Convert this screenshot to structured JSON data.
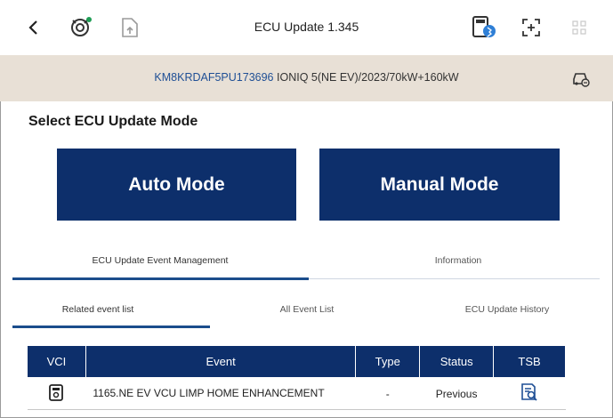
{
  "header": {
    "title": "ECU Update 1.345",
    "icons": [
      "back-chevron-icon",
      "vci-connection-icon",
      "upload-file-icon",
      "vci-bluetooth-icon",
      "expand-icon",
      "menu-grid-icon"
    ]
  },
  "vehicle": {
    "vin": "KM8KRDAF5PU173696",
    "description": "IONIQ 5(NE EV)/2023/70kW+160kW"
  },
  "mode_section": {
    "title": "Select ECU Update Mode",
    "auto_label": "Auto Mode",
    "manual_label": "Manual Mode"
  },
  "primary_tabs": [
    {
      "label": "ECU Update Event Management",
      "active": true
    },
    {
      "label": "Information",
      "active": false
    }
  ],
  "secondary_tabs": [
    {
      "label": "Related event list",
      "active": true
    },
    {
      "label": "All Event List",
      "active": false
    },
    {
      "label": "ECU Update History",
      "active": false
    }
  ],
  "table": {
    "columns": [
      "VCI",
      "Event",
      "Type",
      "Status",
      "TSB"
    ],
    "rows": [
      {
        "event": "1165.NE EV VCU LIMP HOME ENHANCEMENT",
        "type": "-",
        "status": "Previous"
      }
    ]
  },
  "colors": {
    "primary": "#0d2f6b",
    "vehicle_bar": "#e8e0d6",
    "vin_text": "#1f4f95",
    "tab_underline": "#1b4d8c"
  }
}
